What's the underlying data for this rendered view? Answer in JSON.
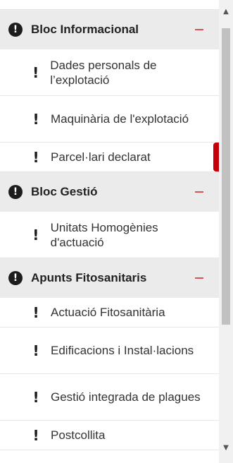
{
  "sections": [
    {
      "title": "Bloc Informacional",
      "section_icon": "exclamation-circle-icon",
      "items": [
        {
          "label": "Dades personals de l’explotació"
        },
        {
          "label": "Maquinària de l'explotació"
        },
        {
          "label": "Parcel·lari declarat",
          "active": true
        }
      ]
    },
    {
      "title": "Bloc Gestió",
      "section_icon": "exclamation-circle-icon",
      "items": [
        {
          "label": "Unitats Homogènies d'actuació"
        }
      ]
    },
    {
      "title": "Apunts Fitosanitaris",
      "section_icon": "exclamation-circle-icon",
      "items": [
        {
          "label": "Actuació Fitosanitària"
        },
        {
          "label": "Edificacions i Instal·lacions"
        },
        {
          "label": "Gestió integrada de plagues"
        },
        {
          "label": "Postcollita"
        }
      ]
    }
  ],
  "icons": {
    "section": "!",
    "item": "!",
    "collapse": "minus-icon",
    "scroll_up": "▲",
    "scroll_down": "▼"
  },
  "colors": {
    "section_bg": "#ebebeb",
    "collapse": "#d9534f",
    "active_marker": "#c5000b"
  }
}
